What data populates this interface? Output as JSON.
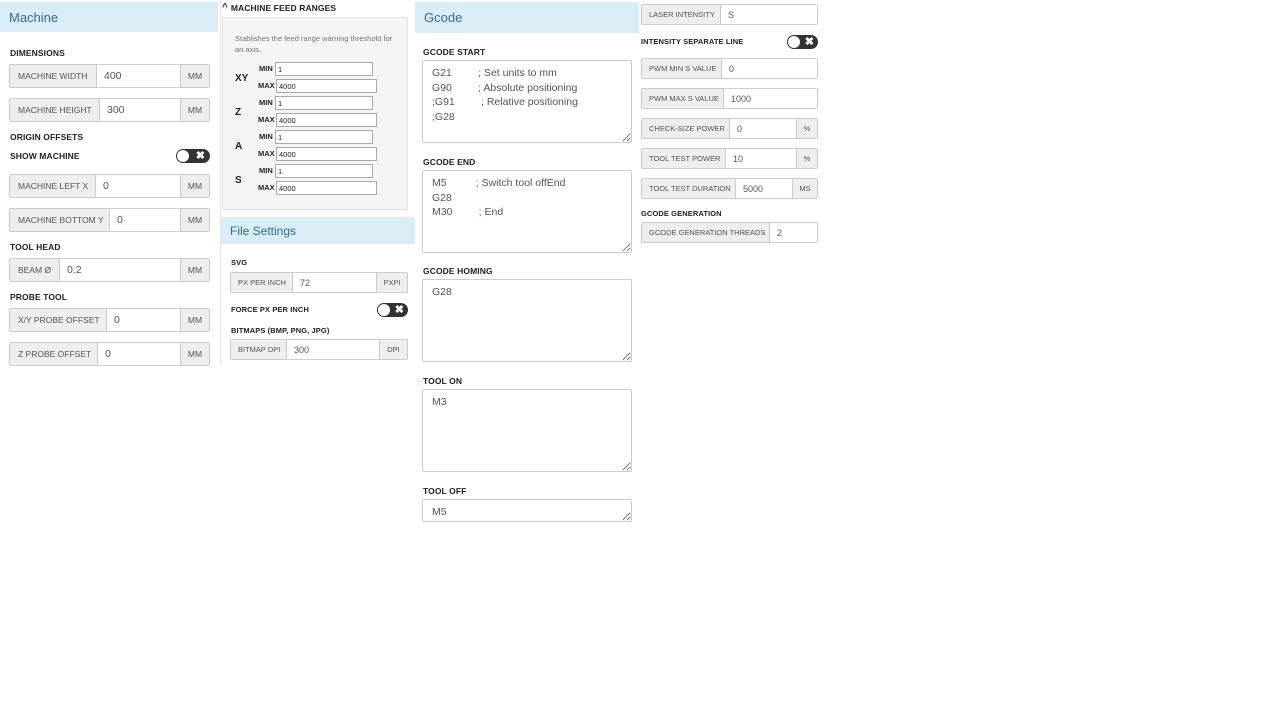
{
  "machine": {
    "title": "Machine",
    "dimensions_label": "DIMENSIONS",
    "width": {
      "label": "MACHINE WIDTH",
      "value": "400",
      "unit": "MM"
    },
    "height": {
      "label": "MACHINE HEIGHT",
      "value": "300",
      "unit": "MM"
    },
    "origin_offsets_label": "ORIGIN OFFSETS",
    "show_machine_label": "SHOW MACHINE",
    "left_x": {
      "label": "MACHINE LEFT X",
      "value": "0",
      "unit": "MM"
    },
    "bottom_y": {
      "label": "MACHINE BOTTOM Y",
      "value": "0",
      "unit": "MM"
    },
    "tool_head_label": "TOOL HEAD",
    "beam": {
      "label": "BEAM Ø",
      "value": "0.2",
      "unit": "MM"
    },
    "probe_tool_label": "PROBE TOOL",
    "xy_probe": {
      "label": "X/Y PROBE OFFSET",
      "value": "0",
      "unit": "MM"
    },
    "z_probe": {
      "label": "Z PROBE OFFSET",
      "value": "0",
      "unit": "MM"
    }
  },
  "feed": {
    "title": "MACHINE FEED RANGES",
    "description": "Stablishes the feed range warning threshold for an axis.",
    "min_label": "MIN",
    "max_label": "MAX",
    "axes": [
      {
        "name": "XY",
        "min": "1",
        "max": "4000"
      },
      {
        "name": "Z",
        "min": "1",
        "max": "4000"
      },
      {
        "name": "A",
        "min": "1",
        "max": "4000"
      },
      {
        "name": "S",
        "min": "1",
        "max": "4000"
      }
    ]
  },
  "file_settings": {
    "title": "File Settings",
    "svg_label": "SVG",
    "px_per_inch": {
      "label": "PX PER INCH",
      "value": "72",
      "unit": "PXPI"
    },
    "force_label": "FORCE PX PER INCH",
    "bitmaps_label": "BITMAPS (BMP, PNG, JPG)",
    "bitmap_dpi": {
      "label": "BITMAP DPI",
      "value": "300",
      "unit": "DPI"
    }
  },
  "gcode": {
    "title": "Gcode",
    "start_label": "GCODE START",
    "start_value": "G21         ; Set units to mm\nG90         ; Absolute positioning\n;G91         ; Relative positioning\n;G28",
    "end_label": "GCODE END",
    "end_value": "M5          ; Switch tool offEnd\nG28\nM30         ; End",
    "homing_label": "GCODE HOMING",
    "homing_value": "G28",
    "tool_on_label": "TOOL ON",
    "tool_on_value": "M3",
    "tool_off_label": "TOOL OFF",
    "tool_off_value": "M5"
  },
  "laser": {
    "intensity": {
      "label": "LASER INTENSITY",
      "value": "S"
    },
    "separate_line_label": "INTENSITY SEPARATE LINE",
    "pwm_min": {
      "label": "PWM MIN S VALUE",
      "value": "0"
    },
    "pwm_max": {
      "label": "PWM MAX S VALUE",
      "value": "1000"
    },
    "check_size": {
      "label": "CHECK-SIZE POWER",
      "value": "0",
      "unit": "%"
    },
    "test_power": {
      "label": "TOOL TEST POWER",
      "value": "10",
      "unit": "%"
    },
    "test_duration": {
      "label": "TOOL TEST DURATION",
      "value": "5000",
      "unit": "MS"
    },
    "generation_label": "GCODE GENERATION",
    "threads": {
      "label": "GCODE GENERATION THREADS",
      "value": "2"
    }
  }
}
